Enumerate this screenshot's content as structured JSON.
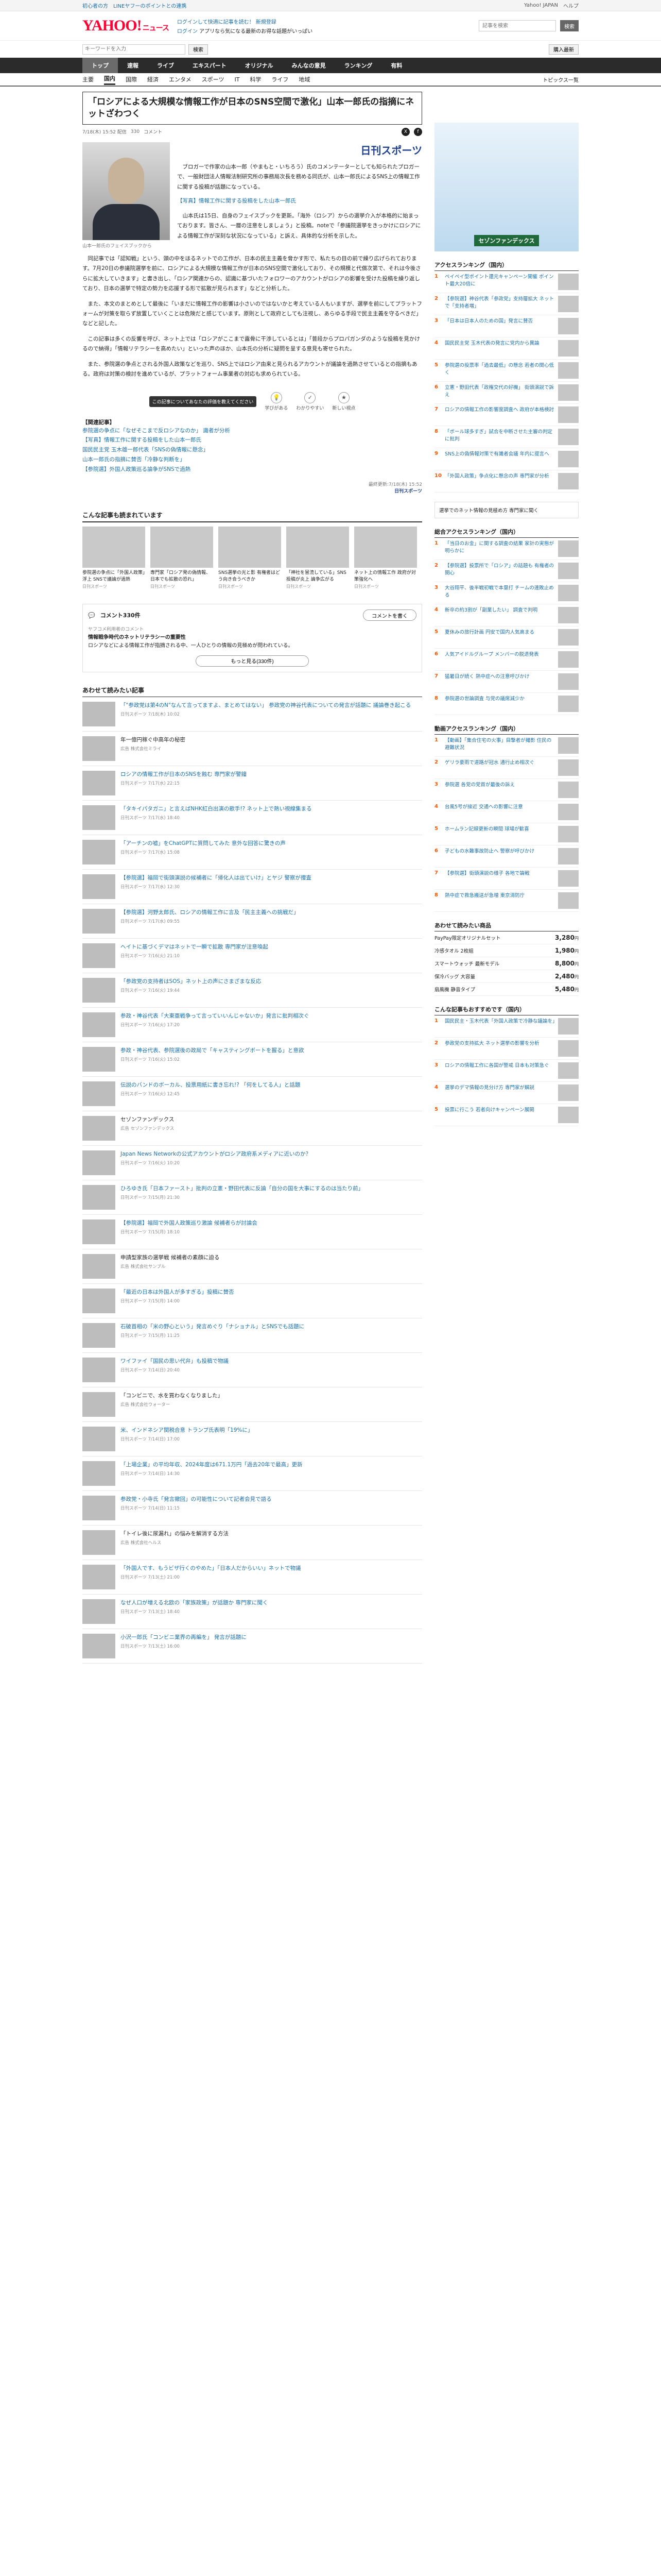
{
  "topbar": {
    "links": [
      "初心者の方",
      "LINEヤフーのポイントとの連携"
    ],
    "right_link": "Yahoo! JAPAN",
    "help": "ヘルプ"
  },
  "header": {
    "logo": "YAHOO!",
    "logo_sub": "ニュース",
    "top_links": [
      "ログインして快適に記事を読む！ 新規登録"
    ],
    "login_links": [
      "ログイン",
      "アプリなら気になる最新のお得な話題がいっぱい"
    ],
    "search_placeholder": "記事を検索",
    "search_button": "検索"
  },
  "searchrow": {
    "left_placeholder": "キーワードを入力",
    "left_button": "検索",
    "right_button": "購入最新"
  },
  "nav1": [
    "トップ",
    "速報",
    "ライブ",
    "エキスパート",
    "オリジナル",
    "みんなの意見",
    "ランキング",
    "有料"
  ],
  "nav2": [
    "主要",
    "国内",
    "国際",
    "経済",
    "エンタメ",
    "スポーツ",
    "IT",
    "科学",
    "ライフ",
    "地域"
  ],
  "nav2_more": "トピックス一覧",
  "article": {
    "title": "「ロシアによる大規模な情報工作が日本のSNS空間で激化」山本一郎氏の指摘にネットざわつく",
    "date": "7/18(木) 15:52 配信",
    "comments": "330",
    "reactions": "コメント",
    "source": "日刊スポーツ",
    "caption": "山本一郎氏のフェイスブックから",
    "paragraphs": [
      "ブロガーで作家の山本一郎（やまもと・いちろう）氏のコメンテーターとしても知られたプロガーで、一般財団法人情報法制研究所の事務局次長を務める同氏が、山本一郎氏によるSNS上の情報工作に関する投稿が話題になっている。",
      "【写真】情報工作に関する投稿をした山本一郎氏",
      "山本氏は15日、自身のフェイスブックを更新。「海外（ロシア）からの選挙介入が本格的に始まっております。皆さん、一層の注意をしましょう」と投稿。noteで「参議院選挙をきっかけにロシアによる情報工作が深刻な状況になっている」と訴え、具体的な分析を示した。",
      "同記事では「認知戦」という、頭の中をほるネットでの工作が、日本の民主主義を脅かす形で、私たちの目の前で繰り広げられております。7月20日の参議院選挙を前に、ロシアによる大規模な情報工作が日本のSNS空間で激化しており、その規模と代償次第で、それは今後さらに拡大していきます」と書き出し、「ロシア関連からの、認識に基づいたフォロワーのアカウントがロシアの影響を受けた投稿を繰り返しており、日本の選挙で特定の勢力を応援する形で拡散が見られます」などと分析した。",
      "また、本文のまとめとして最後に「いまだに情報工作の影響は小さいのではないかと考えている人もいますが、選挙を前にしてプラットフォームが対策を取らず放置していくことは危険だと感じています。原則として政府としても注視し、あらゆる手段で民主主義を守るべきだ」などと記した。",
      "この記事は多くの反響を呼び、ネット上では「ロシアがここまで露骨に干渉しているとは」「普段からプロパガンダのような投稿を見かけるので納得」「情報リテラシーを高めたい」といった声のほか、山本氏の分析に疑問を呈する意見も寄せられた。",
      "また、参院選の争点とされる外国人政策などを巡り、SNS上ではロシア由来と見られるアカウントが議論を過熱させているとの指摘もある。政府は対策の検討を進めているが、プラットフォーム事業者の対応も求められている。"
    ],
    "related_head": "【関連記事】",
    "related": [
      "参院選の争点に「なぜそこまで反ロシアなのか」 識者が分析",
      "【写真】情報工作に関する投稿をした山本一郎氏",
      "国民民主党 玉木雄一郎代表「SNSの偽情報に懸念」",
      "山本一郎氏の指摘に賛否「冷静な判断を」",
      "【参院選】外国人政策巡る論争がSNSで過熱"
    ],
    "posted": "最終更新:7/18(木) 15:52",
    "posted_src": "日刊スポーツ",
    "actions": [
      "学びがある",
      "わかりやすい",
      "新しい視点"
    ],
    "tooltip": "この記事についてあなたの評価を教えてください"
  },
  "recommend": {
    "title": "こんな記事も読まれています",
    "items": [
      {
        "t": "参院選の争点に「外国人政策」浮上 SNSで議論が過熱",
        "s": "日刊スポーツ"
      },
      {
        "t": "専門家「ロシア発の偽情報、日本でも拡散の恐れ」",
        "s": "日刊スポーツ"
      },
      {
        "t": "SNS選挙の光と影 有権者はどう向き合うべきか",
        "s": "日刊スポーツ"
      },
      {
        "t": "「神社を冒涜している」SNS投稿が炎上 論争広がる",
        "s": "日刊スポーツ"
      },
      {
        "t": "ネット上の情報工作 政府が対策強化へ",
        "s": "日刊スポーツ"
      }
    ]
  },
  "comments_box": {
    "label": "コメント330件",
    "button": "コメントを書く",
    "expert_tag": "ヤフコメ利用者のコメント",
    "expert_title": "情報戦争時代のネットリテラシーの重要性",
    "expert_line": "ロシアなどによる情報工作が指摘される中、一人ひとりの情報の見極めが問われている。",
    "more": "もっと見る(330件)"
  },
  "list": {
    "title": "あわせて読みたい記事",
    "items": [
      {
        "t": "「\"参政党は第4のN\"なんて言ってますよ、まとめてはない」 参政党の神谷代表についての発言が話題に 議論巻き起こる",
        "s": "日刊スポーツ 7/18(木) 10:02",
        "ad": false
      },
      {
        "t": "年一億円稼ぐ中高年の秘密",
        "s": "広告 株式会社ミライ",
        "ad": true
      },
      {
        "t": "ロシアの情報工作が日本のSNSを蝕む 専門家が警鐘",
        "s": "日刊スポーツ 7/17(水) 22:15",
        "ad": false
      },
      {
        "t": "「タキイパタガニ」と言えばNHK紅白出演の歌手!? ネット上で熱い視線集まる",
        "s": "日刊スポーツ 7/17(水) 18:40",
        "ad": false
      },
      {
        "t": "「アーチンの嘘」をChatGPTに質問してみた 意外な回答に驚きの声",
        "s": "日刊スポーツ 7/17(水) 15:08",
        "ad": false
      },
      {
        "t": "【参院選】福岡で街頭演説の候補者に「帰化人は出ていけ」とヤジ 警察が捜査",
        "s": "日刊スポーツ 7/17(水) 12:30",
        "ad": false
      },
      {
        "t": "【参院選】河野太郎氏、ロシアの情報工作に言及「民主主義への挑戦だ」",
        "s": "日刊スポーツ 7/17(水) 09:55",
        "ad": false
      },
      {
        "t": "ヘイトに基づくデマはネットで一瞬で拡散 専門家が注意喚起",
        "s": "日刊スポーツ 7/16(火) 21:10",
        "ad": false
      },
      {
        "t": "「参政党の支持者はSOS」ネット上の声にさまざまな反応",
        "s": "日刊スポーツ 7/16(火) 19:44",
        "ad": false
      },
      {
        "t": "参政・神谷代表「大東亜戦争って言っていいんじゃないか」発言に批判相次ぐ",
        "s": "日刊スポーツ 7/16(火) 17:20",
        "ad": false
      },
      {
        "t": "参政・神谷代表、参院選後の政局で「キャスティングボートを握る」と意欲",
        "s": "日刊スポーツ 7/16(火) 15:02",
        "ad": false
      },
      {
        "t": "伝説のバンドのボーカル、投票用紙に書き忘れ!? 「何をしてる人」と話題",
        "s": "日刊スポーツ 7/16(火) 12:45",
        "ad": false
      },
      {
        "t": "セゾンファンデックス",
        "s": "広告 セゾンファンデックス",
        "ad": true
      },
      {
        "t": "Japan News Networkの公式アカウントがロシア政府系メディアに近いのか？",
        "s": "日刊スポーツ 7/16(火) 10:20",
        "ad": false
      },
      {
        "t": "ひろゆき氏「日本ファースト」批判の立憲・野田代表に反論「自分の国を大事にするのは当たり前」",
        "s": "日刊スポーツ 7/15(月) 21:30",
        "ad": false
      },
      {
        "t": "【参院選】福岡で外国人政策巡り激論 候補者らが討論会",
        "s": "日刊スポーツ 7/15(月) 18:10",
        "ad": false
      },
      {
        "t": "申請型家族の選挙戦 候補者の素顔に迫る",
        "s": "広告 株式会社サンプル",
        "ad": true
      },
      {
        "t": "「最近の日本は外国人が多すぎる」投稿に賛否",
        "s": "日刊スポーツ 7/15(月) 14:00",
        "ad": false
      },
      {
        "t": "石破首相の「米の野心という」発言めぐり「ナショナル」とSNSでも話題に",
        "s": "日刊スポーツ 7/15(月) 11:25",
        "ad": false
      },
      {
        "t": "ワイファイ「国民の思い代弁」も投稿で物議",
        "s": "日刊スポーツ 7/14(日) 20:40",
        "ad": false
      },
      {
        "t": "「コンビニで、水を買わなくなりました」",
        "s": "広告 株式会社ウォーター",
        "ad": true
      },
      {
        "t": "米、インドネシア関税合意 トランプ氏表明「19%に」",
        "s": "日刊スポーツ 7/14(日) 17:00",
        "ad": false
      },
      {
        "t": "「上場企業」の平均年収、2024年度は671.1万円「過去20年で最高」更新",
        "s": "日刊スポーツ 7/14(日) 14:30",
        "ad": false
      },
      {
        "t": "参政党・小寺氏「発言撤回」の可能性について記者会見で語る",
        "s": "日刊スポーツ 7/14(日) 11:15",
        "ad": false
      },
      {
        "t": "「トイレ後に尿漏れ」の悩みを解消する方法",
        "s": "広告 株式会社ヘルス",
        "ad": true
      },
      {
        "t": "「外国人です、もうビザ行くのやめた」「日本人だからいい」ネットで物議",
        "s": "日刊スポーツ 7/13(土) 21:00",
        "ad": false
      },
      {
        "t": "なぜ人口が増える北欧の「家族政策」が話題か 専門家に聞く",
        "s": "日刊スポーツ 7/13(土) 18:40",
        "ad": false
      },
      {
        "t": "小沢一郎氏「コンビニ業界の再編を」 発言が話題に",
        "s": "日刊スポーツ 7/13(土) 16:00",
        "ad": false
      }
    ]
  },
  "side": {
    "ad_label": "セゾンファンデックス",
    "rank1_title": "アクセスランキング（国内）",
    "rank1": [
      "ペイペイ型ポイント還元キャンペーン開催 ポイント最大20倍に",
      "【参院選】神谷代表「参政党」支持層拡大 ネットで「支持者増」",
      "「日本は日本人のための国」発言に賛否",
      "国民民主党 玉木代表の発言に党内から異論",
      "参院選の投票率「過去最低」の懸念 若者の関心低く",
      "立憲・野田代表「政権交代の好機」 街頭演説で訴え",
      "ロシアの情報工作の影響度調査へ 政府が本格検討",
      "「ボール球多すぎ」試合を中断させた主審の判定に批判",
      "SNS上の偽情報対策で有識者会議 年内に提言へ",
      "「外国人政策」争点化に懸念の声 専門家が分析"
    ],
    "side_link": "選挙でのネット情報の見極め方 専門家に聞く",
    "rank2_title": "総合アクセスランキング（国内）",
    "rank2": [
      "「当日のお金」に関する調査の結果 家計の実態が明らかに",
      "【参院選】投票所で「ロシア」の話題も 有権者の関心",
      "大谷翔平、後半戦初戦で本塁打 チームの連敗止める",
      "新卒の約3割が「副業したい」 調査で判明",
      "夏休みの旅行計画 円安で国内人気高まる",
      "人気アイドルグループ メンバーの脱退発表",
      "猛暑日が続く 熱中症への注意呼びかけ",
      "参院選の世論調査 与党の議席減少か"
    ],
    "rank3_title": "動画アクセスランキング（国内）",
    "rank3": [
      "【動画】「集合住宅の火事」目撃者が撮影 住民の避難状況",
      "ゲリラ豪雨で道路が冠水 通行止め相次ぐ",
      "参院選 各党の党首が最後の訴え",
      "台風5号が接近 交通への影響に注意",
      "ホームラン記録更新の瞬間 球場が歓喜",
      "子どもの水難事故防止へ 警察が呼びかけ",
      "【参院選】街頭演説の様子 各地で論戦",
      "熱中症で救急搬送が急増 東京消防庁"
    ],
    "paypay_title": "あわせて読みたい商品",
    "paypay": [
      {
        "t": "PayPay限定オリジナルセット",
        "p": "3,280"
      },
      {
        "t": "冷感タオル 2枚組",
        "p": "1,980"
      },
      {
        "t": "スマートウォッチ 最新モデル",
        "p": "8,800"
      },
      {
        "t": "保冷バッグ 大容量",
        "p": "2,480"
      },
      {
        "t": "扇風機 静音タイプ",
        "p": "5,480"
      }
    ],
    "rank4_title": "こんな記事もおすすめです（国内）",
    "rank4": [
      "国民民主・玉木代表「外国人政策で冷静な議論を」",
      "参政党の支持拡大 ネット選挙の影響を分析",
      "ロシアの情報工作に各国が警戒 日本も対策急ぐ",
      "選挙のデマ情報の見分け方 専門家が解説",
      "投票に行こう 若者向けキャンペーン展開"
    ],
    "yen": "円"
  }
}
